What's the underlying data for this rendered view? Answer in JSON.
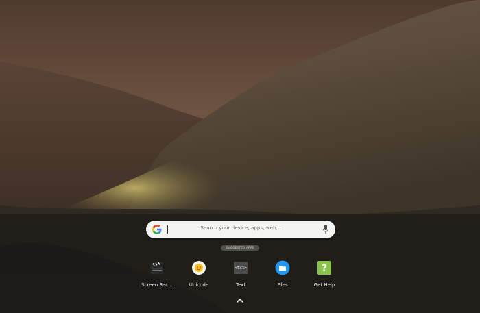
{
  "search": {
    "placeholder": "Search your device, apps, web..."
  },
  "suggested_apps_label": "SUGGESTED APPS",
  "apps": [
    {
      "label": "Screen Rec...",
      "icon": "clapperboard-icon"
    },
    {
      "label": "Unicode",
      "icon": "unicode-smiley-icon"
    },
    {
      "label": "Text",
      "icon": "txt-file-icon"
    },
    {
      "label": "Files",
      "icon": "folder-icon"
    },
    {
      "label": "Get Help",
      "icon": "question-mark-icon"
    }
  ],
  "colors": {
    "files_blue": "#2196f3",
    "get_help_green": "#8bc34a",
    "unicode_yellow": "#fbc02d"
  }
}
